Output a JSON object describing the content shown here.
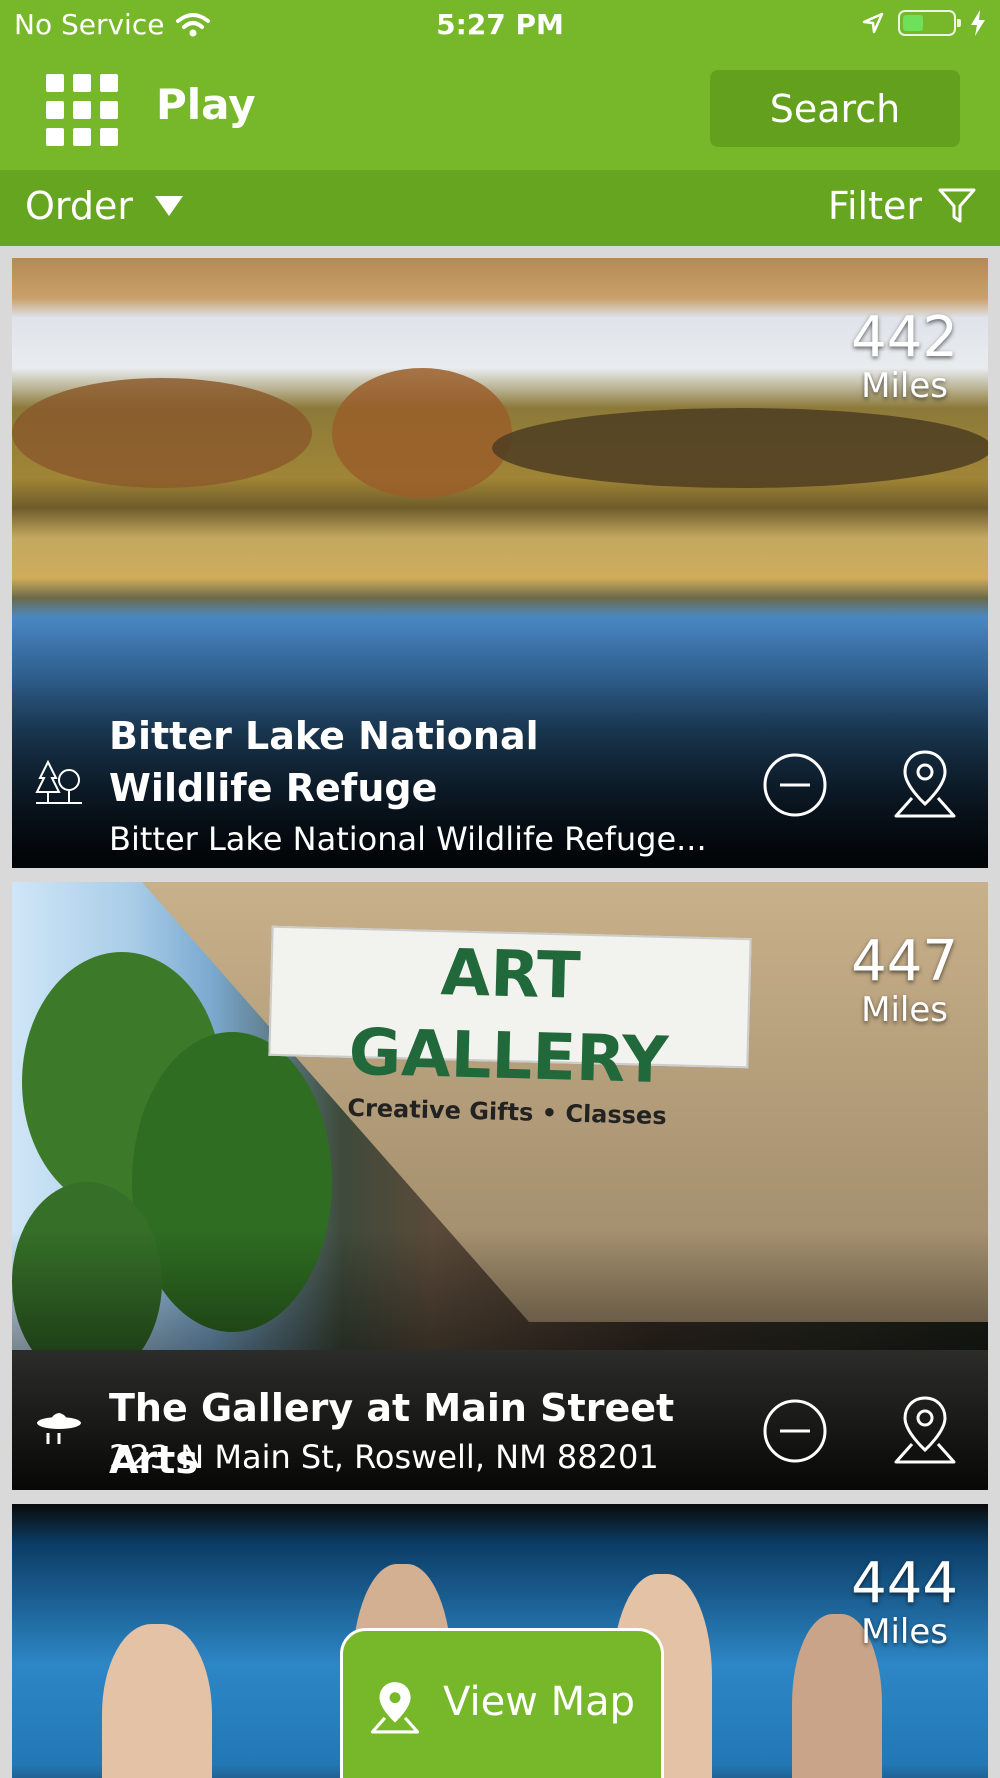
{
  "status_bar": {
    "carrier": "No Service",
    "time": "5:27 PM"
  },
  "nav": {
    "title": "Play",
    "search_label": "Search"
  },
  "subbar": {
    "order_label": "Order",
    "filter_label": "Filter"
  },
  "cards": [
    {
      "distance": "442",
      "unit": "Miles",
      "title": "Bitter Lake National Wildlife Refuge",
      "subtitle": "Bitter Lake National Wildlife Refuge...",
      "category_icon": "trees-icon"
    },
    {
      "distance": "447",
      "unit": "Miles",
      "title": "The Gallery at Main Street Arts",
      "subtitle": "223 N Main St, Roswell, NM 88201",
      "category_icon": "ufo-icon",
      "photo_banner": {
        "line1": "ART GALLERY",
        "line2": "Creative Gifts • Classes"
      }
    },
    {
      "distance": "444",
      "unit": "Miles"
    }
  ],
  "view_map_label": "View Map",
  "colors": {
    "header_green": "#77b82a",
    "subbar_green": "#66a520",
    "search_button_green": "#63a01d"
  }
}
